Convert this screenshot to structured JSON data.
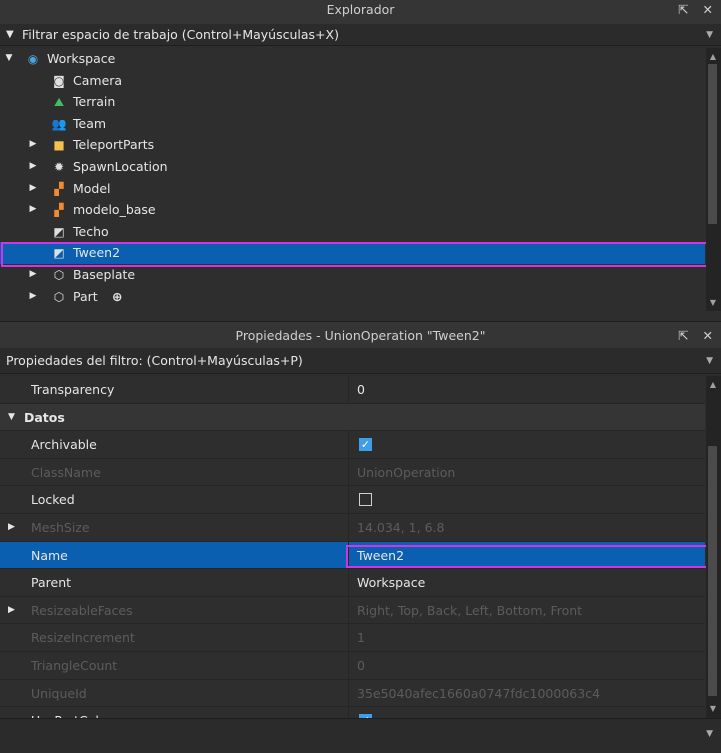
{
  "explorer": {
    "title": "Explorador",
    "undock": "⇱",
    "close": "✕",
    "filter_label": "Filtrar espacio de trabajo (Control+Mayúsculas+X)",
    "items": [
      {
        "label": "Workspace",
        "arrow": "▼",
        "icon": "globe-icon",
        "glyph": "◉",
        "color": "#4aa3df"
      },
      {
        "label": "Camera",
        "arrow": "",
        "icon": "camera-icon",
        "glyph": "◙",
        "color": "#e0e0e0"
      },
      {
        "label": "Terrain",
        "arrow": "",
        "icon": "terrain-icon",
        "glyph": "⛰",
        "color": "#3fbf5f"
      },
      {
        "label": "Team",
        "arrow": "",
        "icon": "team-icon",
        "glyph": "👥",
        "color": "#e0e0e0"
      },
      {
        "label": "TeleportParts",
        "arrow": "▶",
        "icon": "folder-icon",
        "glyph": "■",
        "color": "#f2c14e"
      },
      {
        "label": "SpawnLocation",
        "arrow": "▶",
        "icon": "spawn-icon",
        "glyph": "✹",
        "color": "#e0e0e0"
      },
      {
        "label": "Model",
        "arrow": "▶",
        "icon": "model-icon",
        "glyph": "▞",
        "color": "#f28a2e"
      },
      {
        "label": "modelo_base",
        "arrow": "▶",
        "icon": "model-icon",
        "glyph": "▞",
        "color": "#f28a2e"
      },
      {
        "label": "Techo",
        "arrow": "",
        "icon": "union-icon",
        "glyph": "◩",
        "color": "#e0e0e0"
      },
      {
        "label": "Tween2",
        "arrow": "",
        "icon": "union-icon",
        "glyph": "◩",
        "color": "#e0e0e0"
      },
      {
        "label": "Baseplate",
        "arrow": "▶",
        "icon": "part-icon",
        "glyph": "⬡",
        "color": "#e0e0e0"
      },
      {
        "label": "Part",
        "arrow": "▶",
        "icon": "part-icon",
        "glyph": "⬡",
        "color": "#e0e0e0"
      }
    ]
  },
  "properties": {
    "title": "Propiedades - UnionOperation \"Tween2\"",
    "undock": "⇱",
    "close": "✕",
    "filter_label": "Propiedades del filtro: (Control+Mayúsculas+P)",
    "rows": [
      {
        "name": "Transparency",
        "value": "0",
        "kind": "text"
      },
      {
        "name": "Datos",
        "value": "",
        "kind": "category"
      },
      {
        "name": "Archivable",
        "value": "",
        "kind": "check-on"
      },
      {
        "name": "ClassName",
        "value": "UnionOperation",
        "kind": "disabled"
      },
      {
        "name": "Locked",
        "value": "",
        "kind": "check-off"
      },
      {
        "name": "MeshSize",
        "value": "14.034, 1, 6.8",
        "kind": "disabled-arrow"
      },
      {
        "name": "Name",
        "value": "Tween2",
        "kind": "selected"
      },
      {
        "name": "Parent",
        "value": "Workspace",
        "kind": "text"
      },
      {
        "name": "ResizeableFaces",
        "value": "Right, Top, Back, Left, Bottom, Front",
        "kind": "disabled-arrow"
      },
      {
        "name": "ResizeIncrement",
        "value": "1",
        "kind": "disabled"
      },
      {
        "name": "TriangleCount",
        "value": "0",
        "kind": "disabled"
      },
      {
        "name": "UniqueId",
        "value": "35e5040afec1660a0747fdc1000063c4",
        "kind": "disabled"
      },
      {
        "name": "UsePartColor",
        "value": "",
        "kind": "check-on"
      }
    ]
  },
  "colors": {
    "selection": "#0b5fb0",
    "highlight": "#d233e6",
    "checkbox": "#3e9ee8"
  }
}
